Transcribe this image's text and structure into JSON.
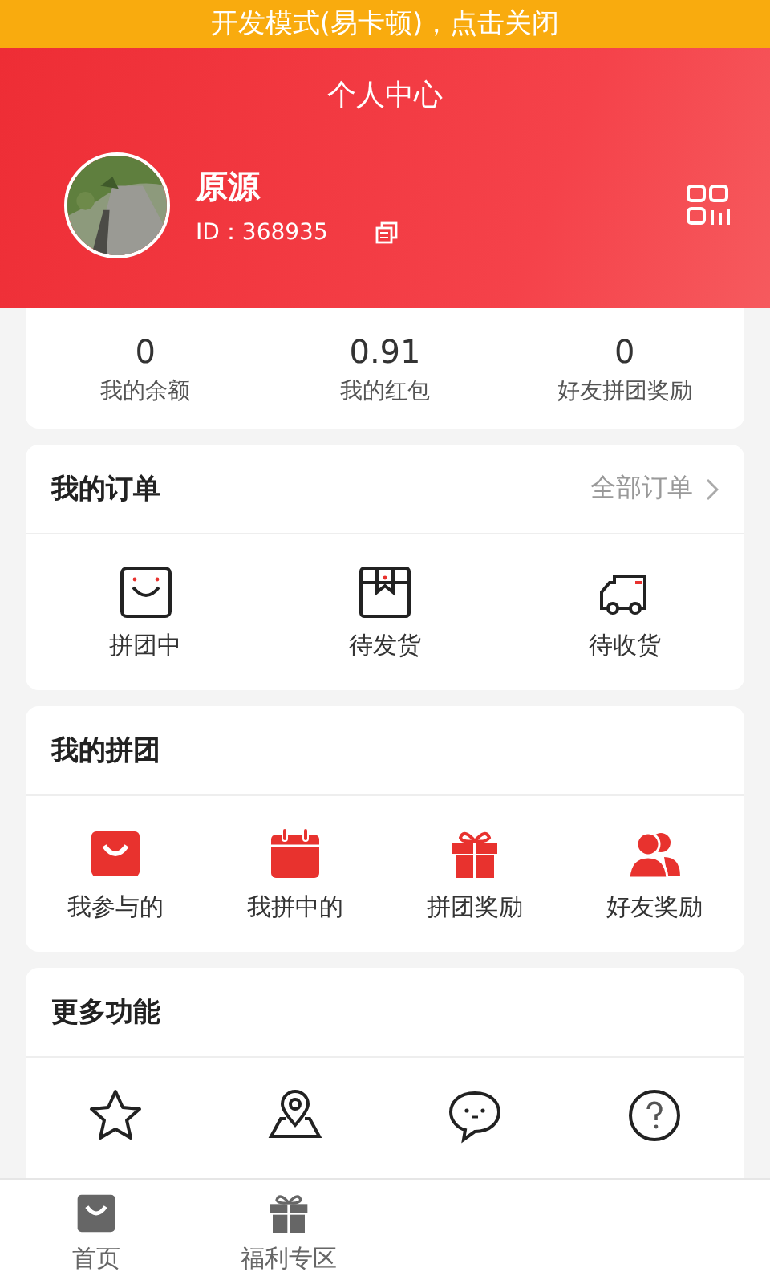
{
  "dev_banner": "开发模式(易卡顿)，点击关闭",
  "header": {
    "title": "个人中心",
    "name": "原源",
    "id_label": "ID：368935"
  },
  "stats": [
    {
      "value": "0",
      "label": "我的余额"
    },
    {
      "value": "0.91",
      "label": "我的红包"
    },
    {
      "value": "0",
      "label": "好友拼团奖励"
    }
  ],
  "orders": {
    "title": "我的订单",
    "link": "全部订单",
    "items": [
      {
        "kind": "bag",
        "label": "拼团中"
      },
      {
        "kind": "box",
        "label": "待发货"
      },
      {
        "kind": "truck",
        "label": "待收货"
      }
    ]
  },
  "group": {
    "title": "我的拼团",
    "items": [
      {
        "kind": "bag",
        "label": "我参与的"
      },
      {
        "kind": "calendar",
        "label": "我拼中的"
      },
      {
        "kind": "gift",
        "label": "拼团奖励"
      },
      {
        "kind": "people",
        "label": "好友奖励"
      }
    ]
  },
  "more": {
    "title": "更多功能",
    "items": [
      {
        "kind": "star"
      },
      {
        "kind": "pin"
      },
      {
        "kind": "chat"
      },
      {
        "kind": "help"
      }
    ]
  },
  "tab_bar": [
    {
      "kind": "bag",
      "label": "首页",
      "selected": false
    },
    {
      "kind": "gift",
      "label": "福利专区",
      "selected": false
    }
  ]
}
